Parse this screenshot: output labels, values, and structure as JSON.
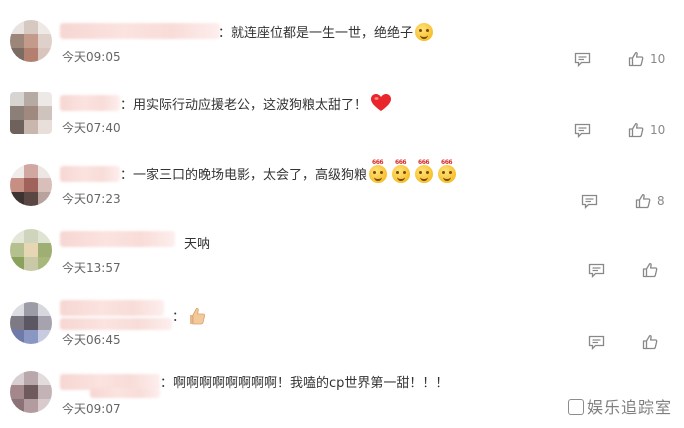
{
  "comments": [
    {
      "text": "：就连座位都是一生一世，绝绝子",
      "time": "今天09:05",
      "emoji": [
        "smile-emoji"
      ],
      "comment_icon": "comment-icon",
      "like_icon": "thumbs-up-icon",
      "likes": "10"
    },
    {
      "text": "：用实际行动应援老公，这波狗粮太甜了！",
      "time": "今天07:40",
      "emoji": [
        "red-heart-emoji"
      ],
      "comment_icon": "comment-icon",
      "like_icon": "thumbs-up-icon",
      "likes": "10"
    },
    {
      "text": "：一家三口的晚场电影，太会了，高级狗粮",
      "time": "今天07:23",
      "emoji": [
        "666-emoji",
        "666-emoji",
        "666-emoji",
        "666-emoji"
      ],
      "emoji_caption": "666",
      "comment_icon": "comment-icon",
      "like_icon": "thumbs-up-icon",
      "likes": "8"
    },
    {
      "text": "天呐",
      "time": "今天13:57",
      "comment_icon": "comment-icon",
      "like_icon": "thumbs-up-icon",
      "likes": ""
    },
    {
      "text": "：",
      "time": "今天06:45",
      "emoji": [
        "thumbs-up-emoji"
      ],
      "comment_icon": "comment-icon",
      "like_icon": "thumbs-up-icon",
      "likes": ""
    },
    {
      "text": "：啊啊啊啊啊啊啊啊！我嗑的cp世界第一甜！！！",
      "time": "今天09:07",
      "comment_icon": "comment-icon",
      "like_icon": "thumbs-up-icon",
      "likes": ""
    }
  ],
  "watermark": "娱乐追踪室",
  "colors": {
    "text": "#333333",
    "time": "#666666",
    "icon": "#888888",
    "name_blur": "#f6d6d2"
  }
}
